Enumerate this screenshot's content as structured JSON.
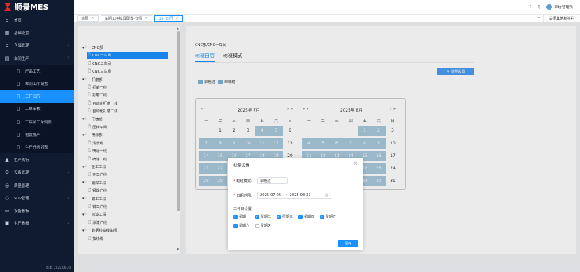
{
  "app": {
    "title": "顺景MES",
    "version": "版本: 2025.06.30"
  },
  "header": {
    "user": "系统管理员"
  },
  "sidebar": {
    "items": [
      {
        "label": "首页",
        "icon": "home-icon",
        "glyph": "⌂",
        "chev": ""
      },
      {
        "label": "基础设置",
        "icon": "grid-icon",
        "glyph": "▦",
        "chev": "⌄"
      },
      {
        "label": "仓储管理",
        "icon": "box-icon",
        "glyph": "⌂",
        "chev": "⌄"
      },
      {
        "label": "车间生产",
        "icon": "factory-icon",
        "glyph": "▤",
        "chev": "⌃"
      },
      {
        "label": "产品工艺",
        "icon": "doc-icon",
        "glyph": "▯",
        "sub": true
      },
      {
        "label": "车间工序配置",
        "icon": "doc-icon",
        "glyph": "▯",
        "sub": true
      },
      {
        "label": "工厂日历",
        "icon": "doc-icon",
        "glyph": "▯",
        "sub": true,
        "active": true
      },
      {
        "label": "工单审核",
        "icon": "doc-icon",
        "glyph": "▯",
        "sub": true
      },
      {
        "label": "工序加工单列表",
        "icon": "doc-icon",
        "glyph": "▯",
        "sub": true
      },
      {
        "label": "包装排产",
        "icon": "doc-icon",
        "glyph": "▯",
        "sub": true
      },
      {
        "label": "生产任务列表",
        "icon": "doc-icon",
        "glyph": "▯",
        "sub": true
      },
      {
        "label": "生产执行",
        "icon": "run-icon",
        "glyph": "▲",
        "chev": "⌄"
      },
      {
        "label": "设备管理",
        "icon": "gear-icon",
        "glyph": "⚙",
        "chev": "⌄"
      },
      {
        "label": "质量管理",
        "icon": "quality-icon",
        "glyph": "◎",
        "chev": "⌄"
      },
      {
        "label": "SOP管理",
        "icon": "sop-icon",
        "glyph": "◌",
        "chev": "⌄"
      },
      {
        "label": "设备看板",
        "icon": "board-icon",
        "glyph": "▭",
        "chev": ""
      },
      {
        "label": "生产看板",
        "icon": "board-icon",
        "glyph": "▣",
        "chev": "⌄"
      }
    ]
  },
  "tabs": [
    {
      "label": "首页",
      "active": false
    },
    {
      "label": "车间工序模具配置-详情",
      "active": false
    },
    {
      "label": "工厂日历",
      "active": true
    }
  ],
  "tabbar": {
    "more": "···",
    "close_other": "关闭其他标签栏"
  },
  "tree": {
    "nodes": [
      {
        "label": "CNC部",
        "level": 0,
        "folder": true
      },
      {
        "label": "CNC一车间",
        "level": 1,
        "selected": true
      },
      {
        "label": "CNC二车间",
        "level": 1
      },
      {
        "label": "CNC三车间",
        "level": 1
      },
      {
        "label": "打磨部",
        "level": 0,
        "folder": true
      },
      {
        "label": "打磨一线",
        "level": 1
      },
      {
        "label": "打磨二线",
        "level": 1
      },
      {
        "label": "自动化打磨一线",
        "level": 1
      },
      {
        "label": "自动化打磨二线",
        "level": 1
      },
      {
        "label": "压铸部",
        "level": 0,
        "folder": true
      },
      {
        "label": "压铸车间",
        "level": 1
      },
      {
        "label": "喷涂部",
        "level": 0,
        "folder": true
      },
      {
        "label": "清洗线",
        "level": 1
      },
      {
        "label": "喷涂一线",
        "level": 1
      },
      {
        "label": "喷涂二线",
        "level": 1
      },
      {
        "label": "金工工段",
        "level": 0,
        "folder": true
      },
      {
        "label": "金工产线",
        "level": 1
      },
      {
        "label": "钢焊工段",
        "level": 0,
        "folder": true
      },
      {
        "label": "钢焊产线",
        "level": 1
      },
      {
        "label": "钳工工段",
        "level": 0,
        "folder": true
      },
      {
        "label": "钳工产线",
        "level": 1
      },
      {
        "label": "涂漆工段",
        "level": 0,
        "folder": true
      },
      {
        "label": "涂漆产线",
        "level": 1
      },
      {
        "label": "数据线抽线车间",
        "level": 0,
        "folder": true
      },
      {
        "label": "抽线线",
        "level": 1
      }
    ]
  },
  "main": {
    "breadcrumb": "CNC部/CNC一车间",
    "tab1": "轮班日历",
    "tab2": "轮班模式",
    "more": "···",
    "batch_button": "批量设置",
    "legend": [
      "早晚班",
      "早晚班"
    ],
    "colors": {
      "accent": "#1890ff",
      "shift": "#a8c8dc"
    }
  },
  "calendar": {
    "nav_prev": "« ‹",
    "nav_next": "› »",
    "weekdays": [
      "一",
      "二",
      "三",
      "四",
      "五",
      "六",
      "日"
    ],
    "left": {
      "title": "2025年 7月",
      "rows": [
        [
          "",
          "1",
          "2",
          "3",
          "4",
          "5",
          "6"
        ],
        [
          "7",
          "8",
          "9",
          "10",
          "11",
          "12",
          "13"
        ],
        [
          "14",
          "15",
          "16",
          "17",
          "18",
          "19",
          "20"
        ],
        [
          "21",
          "22",
          "23",
          "24",
          "25",
          "26",
          "27"
        ],
        [
          "28",
          "29",
          "30",
          "31",
          "",
          "",
          ""
        ]
      ],
      "shaded": [
        "4",
        "5",
        "7",
        "8",
        "9",
        "10",
        "11",
        "12",
        "14",
        "15",
        "16",
        "17",
        "18",
        "19",
        "21",
        "22",
        "28",
        "29"
      ]
    },
    "right": {
      "title": "2025年 8月",
      "rows": [
        [
          "",
          "",
          "",
          "",
          "1",
          "2",
          "3"
        ],
        [
          "4",
          "5",
          "6",
          "7",
          "8",
          "9",
          "10"
        ],
        [
          "11",
          "12",
          "13",
          "14",
          "15",
          "16",
          "17"
        ],
        [
          "18",
          "19",
          "20",
          "21",
          "22",
          "23",
          "24"
        ],
        [
          "25",
          "26",
          "27",
          "28",
          "29",
          "30",
          "31"
        ]
      ],
      "shaded": [
        "1",
        "2",
        "4",
        "5",
        "6",
        "7",
        "8",
        "9",
        "11",
        "12",
        "13",
        "14",
        "15",
        "16",
        "18",
        "19",
        "20",
        "21",
        "22",
        "23",
        "25",
        "26",
        "27",
        "28",
        "29",
        "30"
      ]
    }
  },
  "dialog": {
    "title": "批量设置",
    "close": "×",
    "mode_label": "轮班模式:",
    "mode_value": "早晚班",
    "date_label": "日期范围:",
    "date_from": "2025-07-05",
    "date_sep": "→",
    "date_to": "2025-08-31",
    "workday_label": "工作日设置",
    "days": [
      {
        "label": "星期一",
        "checked": true
      },
      {
        "label": "星期二",
        "checked": true
      },
      {
        "label": "星期三",
        "checked": true
      },
      {
        "label": "星期四",
        "checked": true
      },
      {
        "label": "星期五",
        "checked": true
      },
      {
        "label": "星期六",
        "checked": true
      },
      {
        "label": "星期天",
        "checked": false
      }
    ],
    "save": "保存"
  }
}
